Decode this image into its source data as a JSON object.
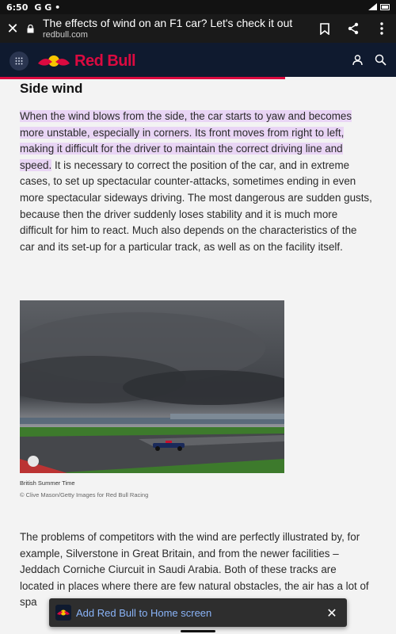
{
  "status_bar": {
    "time": "6:50",
    "notifications": "G G •",
    "icons": [
      "signal-icon",
      "battery-icon"
    ]
  },
  "tab_bar": {
    "title": "The effects of wind on an F1 car? Let's check it out",
    "url": "redbull.com",
    "icons": [
      "close-icon",
      "lock-icon",
      "bookmark-icon",
      "share-icon",
      "more-vert-icon"
    ]
  },
  "site_header": {
    "logo_text": "Red Bull",
    "icons": [
      "grid-menu-icon",
      "red-bull-logo",
      "profile-icon",
      "search-icon"
    ],
    "colors": {
      "bg": "#0f1a2f",
      "brand": "#db0a40"
    }
  },
  "reading_progress": 0.72,
  "article": {
    "section_title": "Side wind",
    "para1_highlighted": "When the wind blows from the side, the car starts to yaw and becomes more unstable, especially in corners. Its front moves from right to left, making it difficult for the driver to maintain the correct driving line and speed.",
    "para1_rest": " It is necessary to correct the position of the car, and in extreme cases, to set up spectacular counter-attacks, sometimes ending in even more spectacular sideways driving. The most dangerous are sudden gusts, because then the driver suddenly loses stability and it is much more difficult for him to react. Much also depends on the characteristics of the car and its set-up for a particular track, as well as on the facility itself.",
    "image_caption": "British Summer Time",
    "image_credit": "© Clive Mason/Getty Images for Red Bull Racing",
    "para2_visible": "The problems of competitors with the wind are perfectly illustrated by, for example, Silverstone in Great Britain, and from the newer facilities – Jeddach Corniche Ciurcuit in Saudi Arabia. Both of these tracks are located in places where there are few natural obstacles, the air has a lot of spa",
    "highlight_color": "#e9d5f5"
  },
  "a2hs_banner": {
    "text": "Add Red Bull to Home screen",
    "close": "✕"
  }
}
